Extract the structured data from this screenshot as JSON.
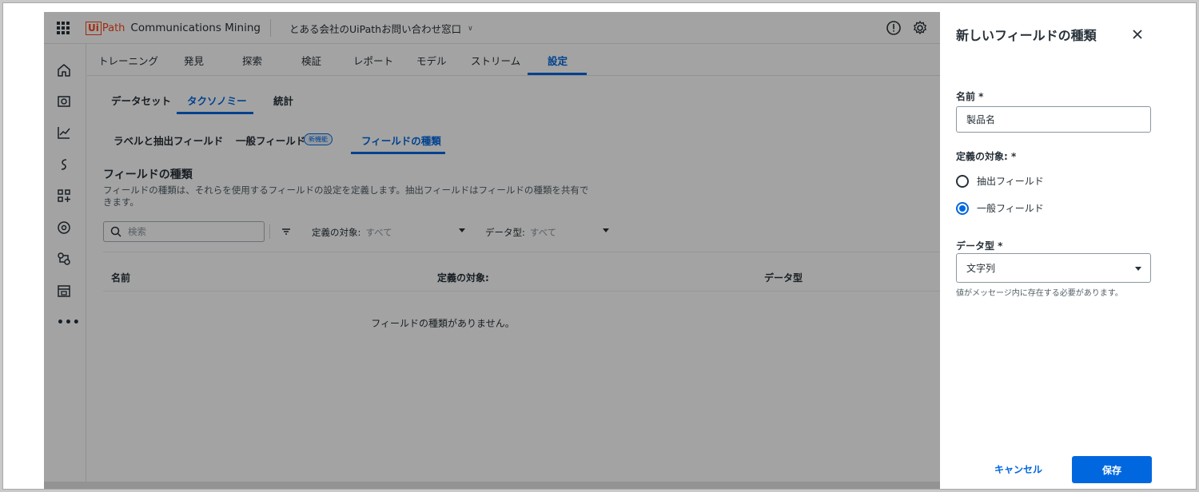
{
  "header": {
    "logo_ui": "Ui",
    "logo_path": "Path",
    "product": "Communications Mining",
    "tenant": "とある会社のUiPathお問い合わせ窓口"
  },
  "topnav": {
    "tabs": [
      "トレーニング",
      "発見",
      "探索",
      "検証",
      "レポート",
      "モデル",
      "ストリーム",
      "設定"
    ],
    "active": "設定"
  },
  "subnav": {
    "tabs": [
      "データセット",
      "タクソノミー",
      "統計"
    ],
    "active": "タクソノミー"
  },
  "subnav2": {
    "tabs": [
      "ラベルと抽出フィールド",
      "一般フィールド",
      "フィールドの種類"
    ],
    "badge": "新機能",
    "active": "フィールドの種類"
  },
  "section": {
    "title": "フィールドの種類",
    "description": "フィールドの種類は、それらを使用するフィールドの設定を定義します。抽出フィールドはフィールドの種類を共有できます。"
  },
  "filters": {
    "search_placeholder": "検索",
    "target_label": "定義の対象:",
    "target_value": "すべて",
    "datatype_label": "データ型:",
    "datatype_value": "すべて"
  },
  "table": {
    "columns": [
      "名前",
      "定義の対象:",
      "データ型"
    ],
    "empty_message": "フィールドの種類がありません。"
  },
  "drawer": {
    "title": "新しいフィールドの種類",
    "name_label": "名前 *",
    "name_value": "製品名",
    "target_label": "定義の対象: *",
    "target_options": [
      "抽出フィールド",
      "一般フィールド"
    ],
    "target_selected": "一般フィールド",
    "datatype_label": "データ型 *",
    "datatype_value": "文字列",
    "datatype_help": "値がメッセージ内に存在する必要があります。",
    "cancel_label": "キャンセル",
    "save_label": "保存"
  },
  "colors": {
    "accent": "#0067df",
    "brand": "#fa4616"
  }
}
